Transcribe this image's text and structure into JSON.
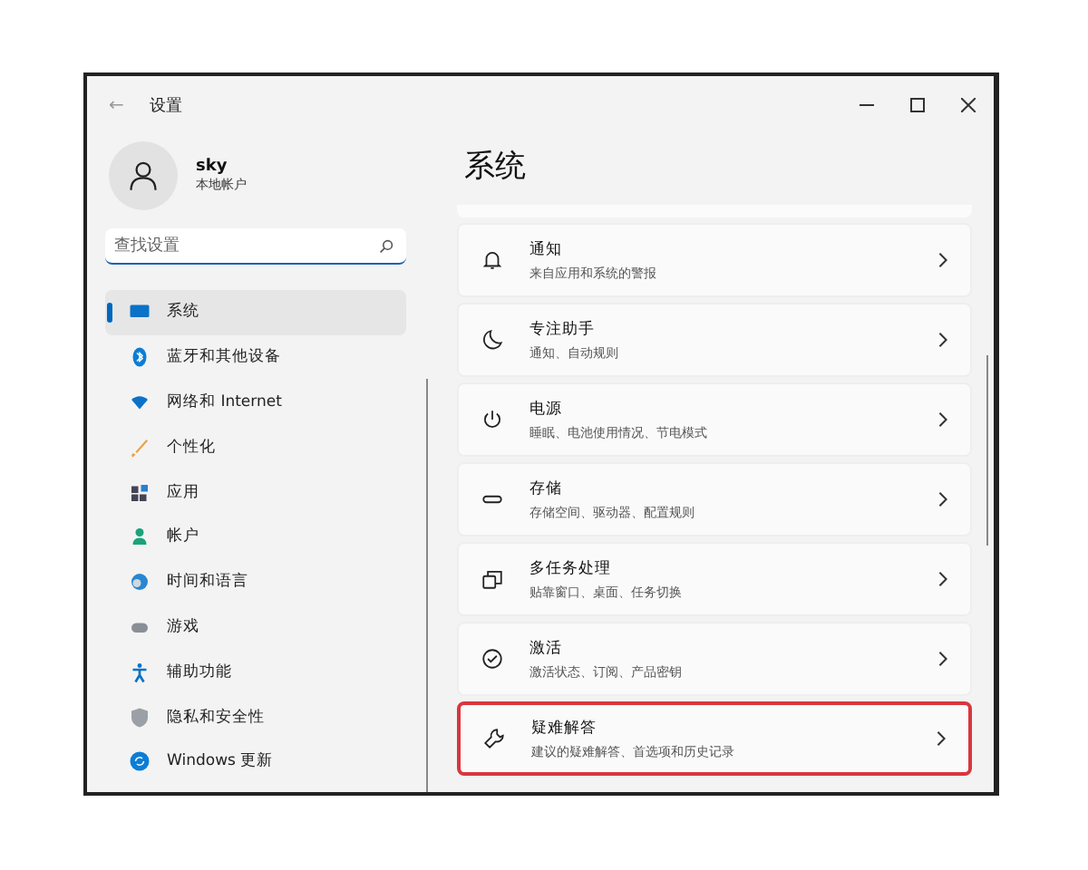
{
  "window": {
    "title": "设置",
    "back": "←"
  },
  "account": {
    "name": "sky",
    "type": "本地帐户"
  },
  "search": {
    "placeholder": "查找设置"
  },
  "sidebar": {
    "items": [
      {
        "label": "系统",
        "selected": true
      },
      {
        "label": "蓝牙和其他设备",
        "selected": false
      },
      {
        "label": "网络和 Internet",
        "selected": false
      },
      {
        "label": "个性化",
        "selected": false
      },
      {
        "label": "应用",
        "selected": false
      },
      {
        "label": "帐户",
        "selected": false
      },
      {
        "label": "时间和语言",
        "selected": false
      },
      {
        "label": "游戏",
        "selected": false
      },
      {
        "label": "辅助功能",
        "selected": false
      },
      {
        "label": "隐私和安全性",
        "selected": false
      },
      {
        "label": "Windows 更新",
        "selected": false
      }
    ]
  },
  "page": {
    "title": "系统",
    "items": [
      {
        "title": "通知",
        "subtitle": "来自应用和系统的警报",
        "highlighted": false
      },
      {
        "title": "专注助手",
        "subtitle": "通知、自动规则",
        "highlighted": false
      },
      {
        "title": "电源",
        "subtitle": "睡眠、电池使用情况、节电模式",
        "highlighted": false
      },
      {
        "title": "存储",
        "subtitle": "存储空间、驱动器、配置规则",
        "highlighted": false
      },
      {
        "title": "多任务处理",
        "subtitle": "贴靠窗口、桌面、任务切换",
        "highlighted": false
      },
      {
        "title": "激活",
        "subtitle": "激活状态、订阅、产品密钥",
        "highlighted": false
      },
      {
        "title": "疑难解答",
        "subtitle": "建议的疑难解答、首选项和历史记录",
        "highlighted": true
      }
    ]
  }
}
